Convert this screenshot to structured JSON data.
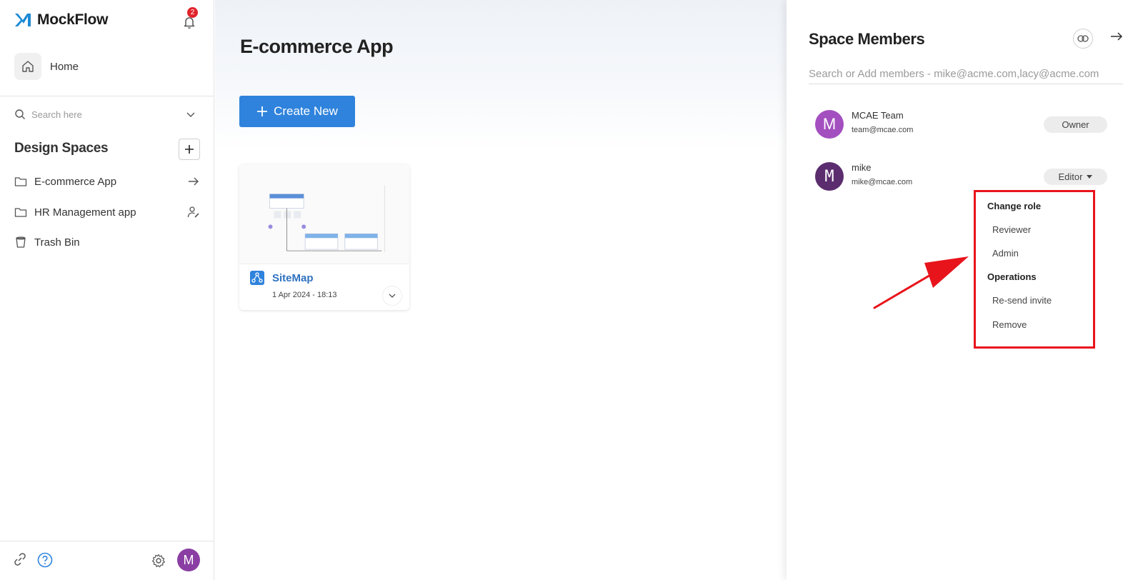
{
  "app": {
    "name": "MockFlow",
    "notification_count": "2"
  },
  "sidebar": {
    "home_label": "Home",
    "search_placeholder": "Search here",
    "section_title": "Design Spaces",
    "spaces": [
      {
        "label": "E-commerce App",
        "trail_icon": "arrow-right-icon"
      },
      {
        "label": "HR Management app",
        "trail_icon": "person-edit-icon"
      },
      {
        "label": "Trash Bin",
        "trail_icon": ""
      }
    ],
    "avatar_letter": "M"
  },
  "main": {
    "title": "E-commerce App",
    "create_label": "Create New",
    "card": {
      "title": "SiteMap",
      "date": "1 Apr 2024 - 18:13"
    }
  },
  "panel": {
    "title": "Space Members",
    "search_placeholder": "Search or Add members - mike@acme.com,lacy@acme.com",
    "members": [
      {
        "initial": "M",
        "name": "MCAE Team",
        "email": "team@mcae.com",
        "role": "Owner",
        "color": "#a34fbf"
      },
      {
        "initial": "M",
        "name": "mike",
        "email": "mike@mcae.com",
        "role": "Editor",
        "color": "#5b2d6e"
      }
    ],
    "menu": {
      "change_role_heading": "Change role",
      "roles": [
        "Reviewer",
        "Admin"
      ],
      "operations_heading": "Operations",
      "operations": [
        "Re-send invite",
        "Remove"
      ]
    }
  },
  "colors": {
    "accent": "#2f83dc",
    "highlight": "#e8141c",
    "badge": "#e0242b"
  }
}
